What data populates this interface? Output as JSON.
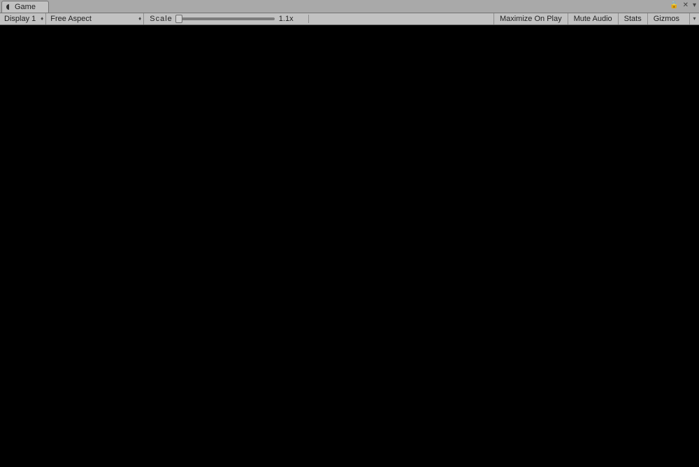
{
  "tab": {
    "label": "Game"
  },
  "toolbar": {
    "display_label": "Display 1",
    "aspect_label": "Free Aspect",
    "scale_label": "Scale",
    "scale_value": "1.1x",
    "maximize_label": "Maximize On Play",
    "mute_label": "Mute Audio",
    "stats_label": "Stats",
    "gizmos_label": "Gizmos"
  }
}
